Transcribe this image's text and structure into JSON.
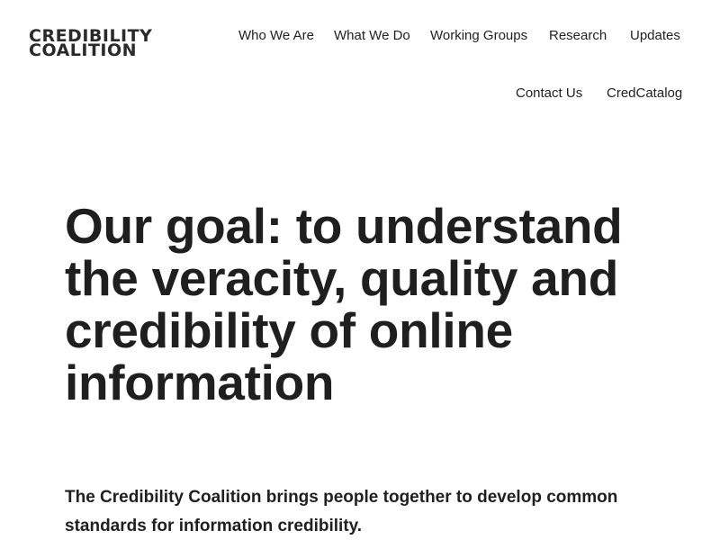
{
  "brand": {
    "logo_line1": "CREDIBILITY",
    "logo_line2": "COALITION"
  },
  "nav": {
    "items": [
      {
        "label": "Who We Are"
      },
      {
        "label": "What We Do"
      },
      {
        "label": "Working Groups"
      },
      {
        "label": "Research"
      },
      {
        "label": "Updates"
      },
      {
        "label": "Contact Us"
      },
      {
        "label": "CredCatalog"
      }
    ]
  },
  "hero": {
    "title": "Our goal: to understand the veracity, quality and credibility of online information",
    "intro": "The Credibility Coalition brings people together to develop common standards for information credibility."
  },
  "colors": {
    "text": "#1f1f1f",
    "background": "#ffffff"
  }
}
